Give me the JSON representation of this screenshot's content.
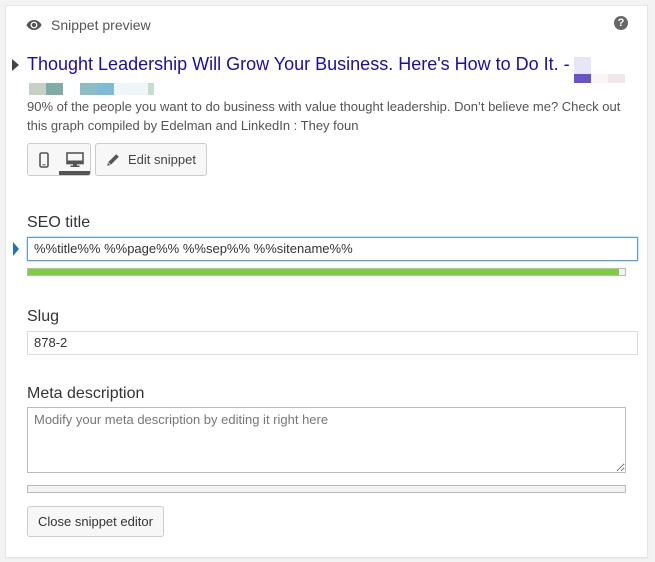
{
  "header": {
    "title": "Snippet preview",
    "eye_icon": "eye-icon",
    "help_icon": "question-circle-icon",
    "help_glyph": "?"
  },
  "snippet": {
    "title": "Thought Leadership Will Grow Your Business. Here's How to Do It. -",
    "description": "90% of the people you want to do business with value thought leadership. Don’t believe me? Check out this graph compiled by Edelman and LinkedIn : They foun",
    "url_blurred": true,
    "title_color": "#1a0dab",
    "description_color": "#545454"
  },
  "toolbar": {
    "mobile_icon": "mobile-icon",
    "desktop_icon": "desktop-icon",
    "active_device": "desktop",
    "edit_label": "Edit snippet",
    "edit_icon": "pencil-icon"
  },
  "seo_title": {
    "label": "SEO title",
    "value": "%%title%% %%page%% %%sep%% %%sitename%%",
    "progress_percent": 99,
    "progress_color": "#7ad03a",
    "focus_color": "#5b9dd9"
  },
  "slug": {
    "label": "Slug",
    "value": "878-2"
  },
  "meta_description": {
    "label": "Meta description",
    "placeholder": "Modify your meta description by editing it right here",
    "value": "",
    "progress_percent": 0
  },
  "footer": {
    "close_label": "Close snippet editor"
  }
}
